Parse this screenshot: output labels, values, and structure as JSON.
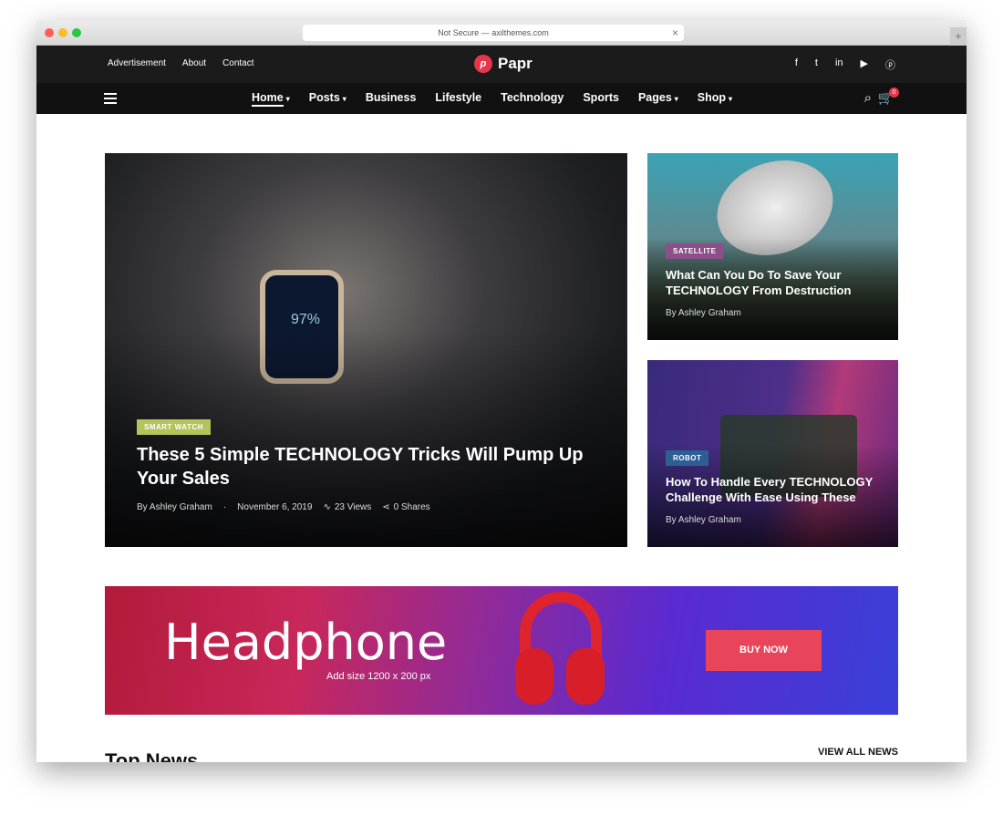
{
  "browser": {
    "url": "Not Secure — axilthemes.com"
  },
  "topbar": {
    "links": [
      "Advertisement",
      "About",
      "Contact"
    ],
    "logo": "Papr",
    "social": [
      "facebook-icon",
      "twitter-icon",
      "linkedin-icon",
      "youtube-icon",
      "pinterest-icon"
    ]
  },
  "nav": {
    "items": [
      "Home",
      "Posts",
      "Business",
      "Lifestyle",
      "Technology",
      "Sports",
      "Pages",
      "Shop"
    ],
    "cart_count": "0"
  },
  "hero": {
    "tag": "SMART WATCH",
    "tag_color": "#b5c35a",
    "title": "These 5 Simple TECHNOLOGY Tricks Will Pump Up Your Sales",
    "author": "By Ashley Graham",
    "date": "November 6, 2019",
    "views": "23 Views",
    "shares": "0 Shares"
  },
  "side": [
    {
      "tag": "SATELLITE",
      "tag_color": "#8c4f8a",
      "title": "What Can You Do To Save Your TECHNOLOGY From Destruction",
      "author": "By Ashley Graham"
    },
    {
      "tag": "ROBOT",
      "tag_color": "#2d5f95",
      "title": "How To Handle Every TECHNOLOGY Challenge With Ease Using These",
      "author": "By Ashley Graham"
    }
  ],
  "banner": {
    "title": "Headphone",
    "subtitle": "Add size 1200 x 200 px",
    "button": "BUY NOW"
  },
  "section": {
    "title": "Top News",
    "view_all": "VIEW ALL NEWS"
  }
}
